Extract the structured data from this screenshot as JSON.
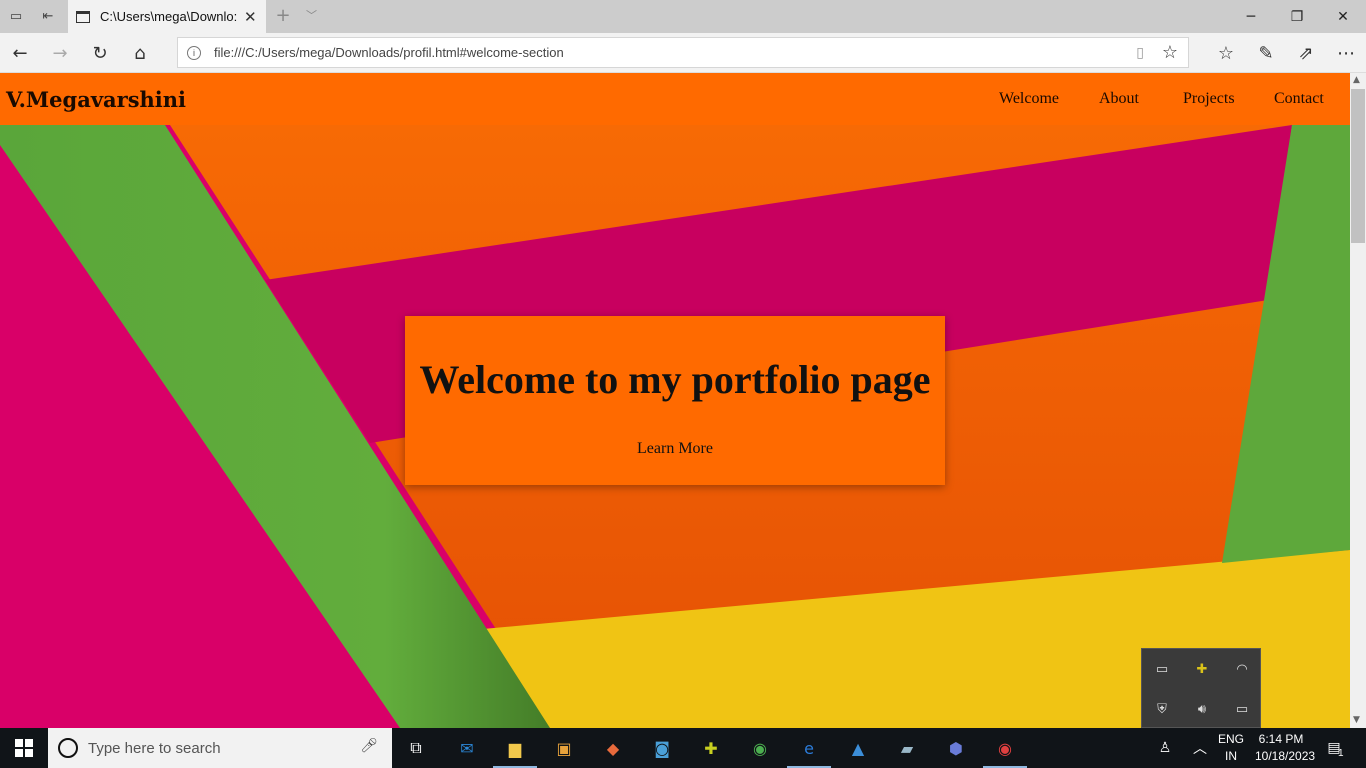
{
  "browser": {
    "tab_title": "C:\\Users\\mega\\Downlo:",
    "url": "file:///C:/Users/mega/Downloads/profil.html#welcome-section"
  },
  "site": {
    "brand": "V.Megavarshini",
    "nav": [
      "Welcome",
      "About",
      "Projects",
      "Contact"
    ],
    "hero_title": "Welcome to my portfolio page",
    "learn_more": "Learn More"
  },
  "colors": {
    "accent_orange": "#ff6a00",
    "magenta": "#d90068",
    "green": "#62ad3c",
    "yellow": "#f0c414"
  },
  "taskbar": {
    "search_placeholder": "Type here to search",
    "lang_line1": "ENG",
    "lang_line2": "IN",
    "time": "6:14 PM",
    "date": "10/18/2023",
    "notifications": "1"
  }
}
